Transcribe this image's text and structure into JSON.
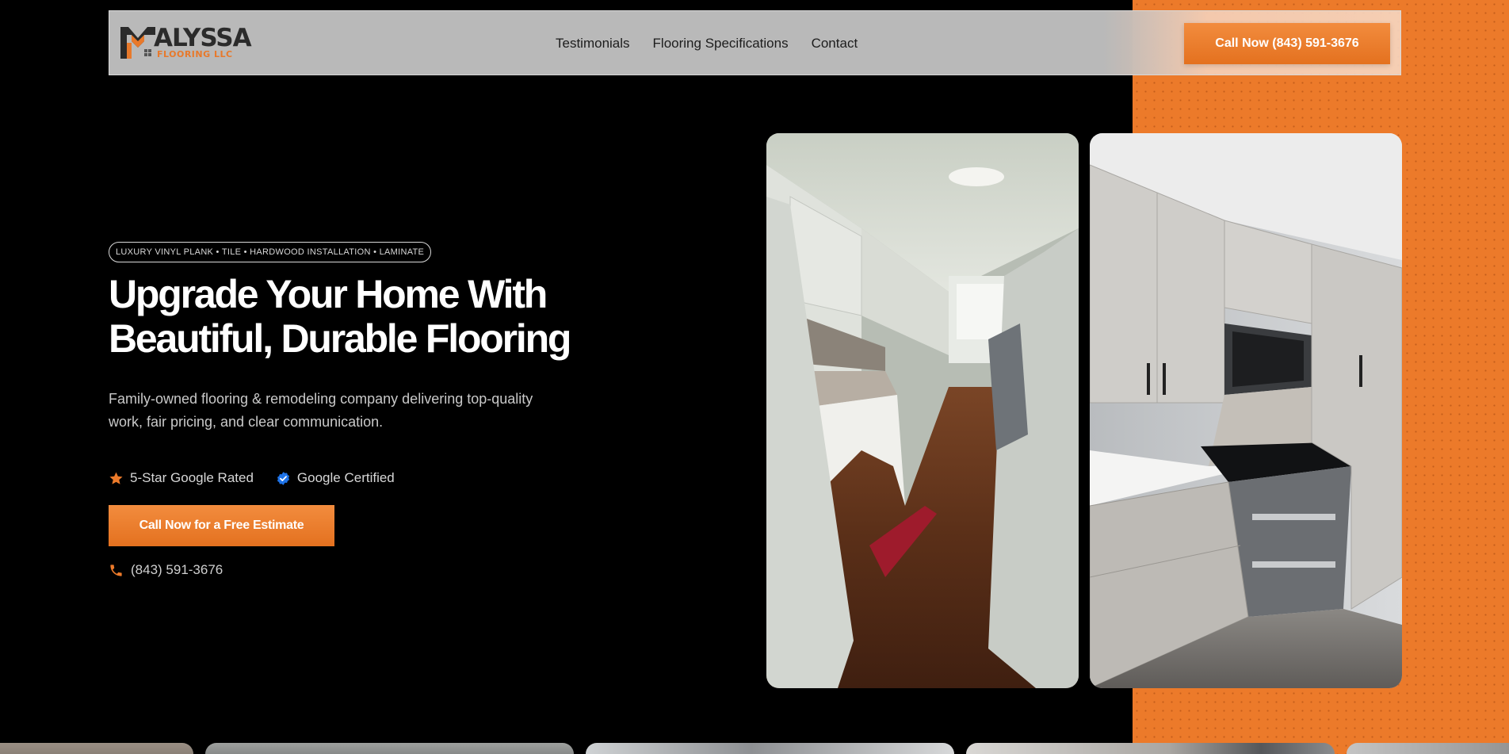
{
  "brand": {
    "name": "ALYSSA",
    "sub": "FLOORING LLC",
    "accent_color": "#E8792B"
  },
  "nav": {
    "items": [
      {
        "label": "Testimonials"
      },
      {
        "label": "Flooring Specifications"
      },
      {
        "label": "Contact"
      }
    ],
    "cta_label": "Call Now (843) 591-3676"
  },
  "hero": {
    "badge": "LUXURY VINYL PLANK • TILE • HARDWOOD INSTALLATION • LAMINATE",
    "headline_line1": "Upgrade Your Home With",
    "headline_line2": "Beautiful, Durable Flooring",
    "subtext": "Family-owned flooring & remodeling company delivering top-quality work, fair pricing, and clear communication.",
    "trust": [
      {
        "icon": "star-icon",
        "label": "5-Star Google Rated"
      },
      {
        "icon": "verified-badge-icon",
        "label": "Google Certified"
      }
    ],
    "cta_label": "Call Now for a Free Estimate",
    "phone": "(843) 591-3676"
  },
  "colors": {
    "background": "#000000",
    "orange_panel": "#EC7A2A",
    "button": "#EC7A2A",
    "verified_blue": "#1E73E8"
  }
}
